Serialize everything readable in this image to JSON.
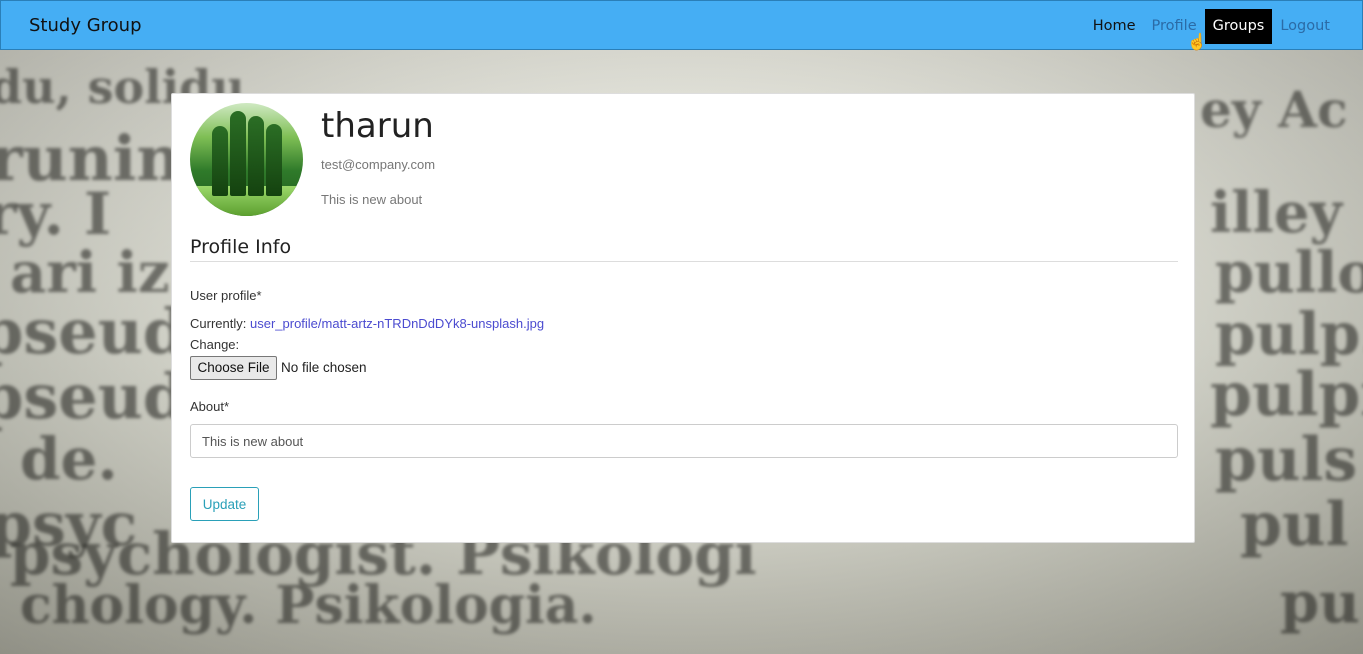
{
  "navbar": {
    "brand": "Study Group",
    "links": [
      "Home",
      "Profile",
      "Groups",
      "Logout"
    ],
    "bg_color": "#45aef4"
  },
  "background_words": [
    "du, solidu",
    "runin",
    "ry. I",
    "ari iz",
    "pseud",
    "pseud",
    "de.",
    "psyc",
    "psychologist. Psikologi",
    "chology. Psikologia.",
    "ey Ac",
    "illey",
    "pullov",
    "pulp.",
    "pulpi",
    "puls",
    "pul",
    "pu"
  ],
  "profile": {
    "username": "tharun",
    "email": "test@company.com",
    "about": "This is new about"
  },
  "form": {
    "section_title": "Profile Info",
    "user_profile_label": "User profile*",
    "currently_label": "Currently:",
    "currently_link": "user_profile/matt-artz-nTRDnDdDYk8-unsplash.jpg",
    "change_label": "Change:",
    "choose_file_label": "Choose File",
    "no_file_text": "No file chosen",
    "about_label": "About*",
    "about_value": "This is new about",
    "update_label": "Update"
  }
}
